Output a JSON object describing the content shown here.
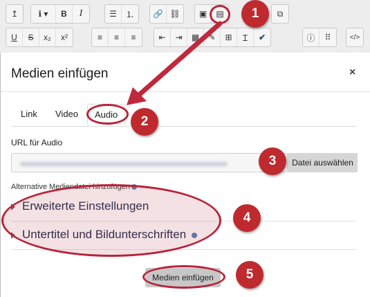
{
  "toolbar": {
    "row1": [
      {
        "icon": "collapse-icon",
        "label": "↥"
      },
      {
        "icon": "paragraph-style-icon",
        "label": "ℹ ▾"
      },
      {
        "icon": "bold-icon",
        "label": "B"
      },
      {
        "icon": "italic-icon",
        "label": "I"
      },
      {
        "icon": "unordered-list-icon",
        "label": "☰"
      },
      {
        "icon": "ordered-list-icon",
        "label": "⒈"
      },
      {
        "icon": "link-icon",
        "label": "🔗"
      },
      {
        "icon": "unlink-icon",
        "label": "⛓"
      },
      {
        "icon": "image-icon",
        "label": "▣"
      },
      {
        "icon": "media-icon",
        "label": "▤"
      },
      {
        "icon": "manage-files-icon",
        "label": "⧉"
      }
    ],
    "row2": [
      {
        "icon": "underline-icon",
        "label": "U"
      },
      {
        "icon": "strikethrough-icon",
        "label": "S"
      },
      {
        "icon": "subscript-icon",
        "label": "x₂"
      },
      {
        "icon": "superscript-icon",
        "label": "x²"
      },
      {
        "icon": "align-left-icon",
        "label": "≡"
      },
      {
        "icon": "align-center-icon",
        "label": "≡"
      },
      {
        "icon": "align-right-icon",
        "label": "≡"
      },
      {
        "icon": "outdent-icon",
        "label": "⇤"
      },
      {
        "icon": "indent-icon",
        "label": "⇥"
      },
      {
        "icon": "equation-icon",
        "label": "▦"
      },
      {
        "icon": "special-char-icon",
        "label": "✎"
      },
      {
        "icon": "table-icon",
        "label": "⊞"
      },
      {
        "icon": "clear-format-icon",
        "label": "Ɪ"
      },
      {
        "icon": "accessibility-checker-icon",
        "label": "✔"
      },
      {
        "icon": "screenreader-helper-icon",
        "label": "ⓘ"
      },
      {
        "icon": "grid-icon",
        "label": "⠿"
      },
      {
        "icon": "html-icon",
        "label": "</>"
      }
    ]
  },
  "modal": {
    "title": "Medien einfügen",
    "close": "×",
    "tabs": [
      "Link",
      "Video",
      "Audio"
    ],
    "url_label": "URL für Audio",
    "url_value": "",
    "file_button": "Datei auswählen",
    "alt_label": "Alternative Mediendatei hinzufügen",
    "section_advanced": "Erweiterte Einstellungen",
    "section_subtitles": "Untertitel und Bildunterschriften",
    "insert_button": "Medien einfügen"
  },
  "badges": [
    "1",
    "2",
    "3",
    "4",
    "5"
  ],
  "colors": {
    "annotation": "#bf2a2e",
    "arrow": "#c0283b",
    "heading": "#1f2d4f"
  }
}
